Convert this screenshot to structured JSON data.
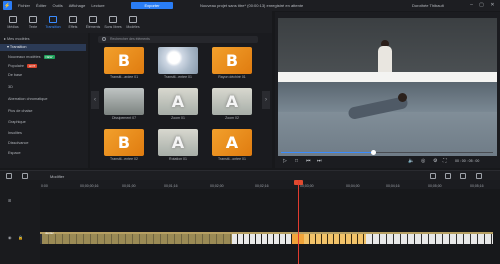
{
  "app": {
    "menus": [
      "Fichier",
      "Éditer",
      "Outils",
      "Affichage",
      "Lecture"
    ],
    "export_label": "Exporter",
    "doc_title": "Nouveau projet sans titre* (00:00:13) enregistré en attente",
    "account": "Dorothée Thibault"
  },
  "toolbar": {
    "tabs": [
      {
        "label": "Médias",
        "icon": "media-icon"
      },
      {
        "label": "Texte",
        "icon": "text-icon"
      },
      {
        "label": "Transition",
        "icon": "transition-icon",
        "active": true
      },
      {
        "label": "Effets",
        "icon": "effects-icon"
      },
      {
        "label": "Éléments",
        "icon": "elements-icon"
      },
      {
        "label": "Sons libres",
        "icon": "audio-icon"
      },
      {
        "label": "Modèles",
        "icon": "templates-icon"
      }
    ]
  },
  "sidebar": {
    "items": [
      {
        "label": "Mes modèles"
      },
      {
        "label": "Transition",
        "active": true
      },
      {
        "label": "Nouveaux modèles",
        "badge": "NEW"
      },
      {
        "label": "Populaire",
        "badge": "HOT"
      },
      {
        "label": "De base"
      },
      {
        "label": "3D"
      },
      {
        "label": "Aberration chromatique"
      },
      {
        "label": "Pics de chaise"
      },
      {
        "label": "Graphique"
      },
      {
        "label": "Insolites"
      },
      {
        "label": "Dissolvance"
      },
      {
        "label": "Espace"
      }
    ]
  },
  "browser": {
    "search_placeholder": "Rechercher des éléments",
    "items": [
      {
        "label": "Transitl...ardee 01",
        "style": "orange",
        "glyph": "B"
      },
      {
        "label": "Transitl...entee 01",
        "style": "photo",
        "glyph": ""
      },
      {
        "label": "Rayon déchiré 01",
        "style": "orange",
        "glyph": "B"
      },
      {
        "label": "Dissipement 07",
        "style": "gray",
        "glyph": ""
      },
      {
        "label": "Zoom 01",
        "style": "light",
        "glyph": "A"
      },
      {
        "label": "Zoom 02",
        "style": "light",
        "glyph": "A"
      },
      {
        "label": "Transitl...entee 02",
        "style": "orange",
        "glyph": "B"
      },
      {
        "label": "Rotation 01",
        "style": "light",
        "glyph": "A"
      },
      {
        "label": "Transitl...ontee 01",
        "style": "orange",
        "glyph": "A"
      }
    ]
  },
  "preview": {
    "timecode": "00 : 00 : 05 : 00",
    "progress": 0.43
  },
  "timeline": {
    "mode_label": "Modifier",
    "ruler": [
      "0:00",
      "00;00;00;16",
      "00;01;00",
      "00;01;16",
      "00;02;00",
      "00;02;16",
      "00;03;00",
      "00;04;00",
      "00;04;16",
      "00;05;00",
      "00;05;16"
    ],
    "clip_label": "deplac",
    "colors": {
      "playhead": "#e03b2f",
      "accent": "#2a7df5"
    }
  }
}
